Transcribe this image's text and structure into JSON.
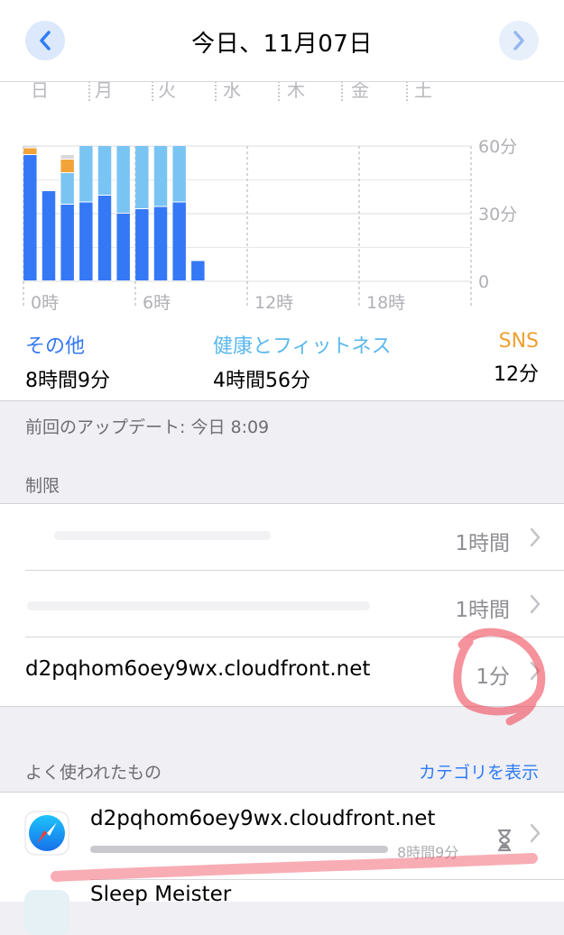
{
  "header": {
    "title": "今日、11月07日",
    "prev_icon": "chevron-left-icon",
    "next_icon": "chevron-right-icon"
  },
  "weekdays": [
    "日",
    "月",
    "火",
    "水",
    "木",
    "金",
    "土"
  ],
  "chart_data": {
    "type": "bar",
    "stacked": true,
    "categories": [
      "0",
      "1",
      "2",
      "3",
      "4",
      "5",
      "6",
      "7",
      "8",
      "9",
      "10",
      "11",
      "12",
      "13",
      "14",
      "15",
      "16",
      "17",
      "18",
      "19",
      "20",
      "21",
      "22",
      "23"
    ],
    "x_tick_labels": [
      "0時",
      "6時",
      "12時",
      "18時"
    ],
    "y_tick_labels": [
      "60分",
      "30分",
      "0"
    ],
    "ylim": [
      0,
      60
    ],
    "series": [
      {
        "name": "その他",
        "color": "#3478f6",
        "values": [
          56,
          40,
          34,
          35,
          38,
          30,
          32,
          33,
          35,
          9,
          0,
          0,
          0,
          0,
          0,
          0,
          0,
          0,
          0,
          0,
          0,
          0,
          0,
          0
        ]
      },
      {
        "name": "健康とフィットネス",
        "color": "#7ac4f4",
        "values": [
          0,
          0,
          14,
          25,
          22,
          30,
          28,
          27,
          25,
          0,
          0,
          0,
          0,
          0,
          0,
          0,
          0,
          0,
          0,
          0,
          0,
          0,
          0,
          0
        ]
      },
      {
        "name": "SNS",
        "color": "#f2a33a",
        "values": [
          3,
          0,
          6,
          0,
          0,
          0,
          0,
          0,
          0,
          0,
          0,
          0,
          0,
          0,
          0,
          0,
          0,
          0,
          0,
          0,
          0,
          0,
          0,
          0
        ]
      },
      {
        "name": "",
        "color": "#d8d8dc",
        "values": [
          1,
          0,
          2,
          0,
          0,
          0,
          0,
          0,
          0,
          0,
          0,
          0,
          0,
          0,
          0,
          0,
          0,
          0,
          0,
          0,
          0,
          0,
          0,
          0
        ]
      }
    ],
    "grid": true
  },
  "legend": [
    {
      "name": "その他",
      "value": "8時間9分",
      "color": "#3478f6"
    },
    {
      "name": "健康とフィットネス",
      "value": "4時間56分",
      "color": "#5ab8ee"
    },
    {
      "name": "SNS",
      "value": "12分",
      "color": "#f0a030"
    }
  ],
  "last_update": "前回のアップデート: 今日 8:09",
  "limits": {
    "header": "制限",
    "rows": [
      {
        "name": "",
        "value": "1時間"
      },
      {
        "name": "",
        "value": "1時間"
      },
      {
        "name": "d2pqhom6oey9wx.cloudfront.net",
        "value": "1分"
      }
    ]
  },
  "most_used": {
    "header": "よく使われたもの",
    "show_categories": "カテゴリを表示",
    "apps": [
      {
        "name": "d2pqhom6oey9wx.cloudfront.net",
        "time": "8時間9分",
        "icon": "safari-compass-icon",
        "progress": 1.0
      },
      {
        "name": "Sleep Meister",
        "icon": "app-icon"
      }
    ]
  },
  "colors": {
    "accent": "#2f7cf6",
    "annotation": "#ef4a5a"
  }
}
